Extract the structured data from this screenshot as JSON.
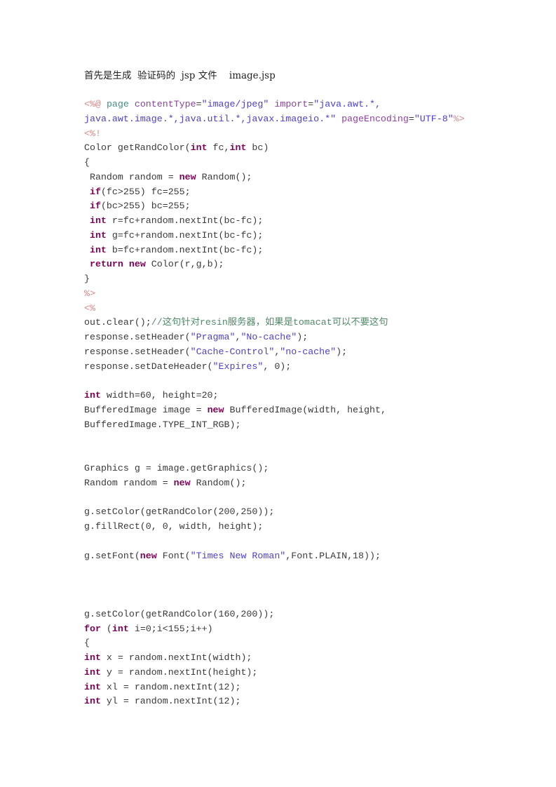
{
  "document": {
    "heading": "首先是生成  验证码的  jsp 文件    image.jsp",
    "code_lines": [
      [
        {
          "t": "tag",
          "v": "<%@"
        },
        {
          "t": "plain",
          "v": " "
        },
        {
          "t": "dir",
          "v": "page"
        },
        {
          "t": "plain",
          "v": " "
        },
        {
          "t": "attr",
          "v": "contentType"
        },
        {
          "t": "plain",
          "v": "="
        },
        {
          "t": "str",
          "v": "\"image/jpeg\""
        },
        {
          "t": "plain",
          "v": " "
        },
        {
          "t": "attr",
          "v": "import"
        },
        {
          "t": "plain",
          "v": "="
        },
        {
          "t": "str",
          "v": "\"java.awt.*,"
        }
      ],
      [
        {
          "t": "str",
          "v": "java.awt.image.*,java.util.*,javax.imageio.*\""
        },
        {
          "t": "plain",
          "v": " "
        },
        {
          "t": "attr",
          "v": "pageEncoding"
        },
        {
          "t": "plain",
          "v": "="
        },
        {
          "t": "str",
          "v": "\"UTF-8\""
        },
        {
          "t": "tag",
          "v": "%>"
        }
      ],
      [
        {
          "t": "tag",
          "v": "<%!"
        }
      ],
      [
        {
          "t": "plain",
          "v": "Color getRandColor("
        },
        {
          "t": "kw",
          "v": "int"
        },
        {
          "t": "plain",
          "v": " fc,"
        },
        {
          "t": "kw",
          "v": "int"
        },
        {
          "t": "plain",
          "v": " bc)"
        }
      ],
      [
        {
          "t": "plain",
          "v": "{"
        }
      ],
      [
        {
          "t": "plain",
          "v": " Random random = "
        },
        {
          "t": "kw",
          "v": "new"
        },
        {
          "t": "plain",
          "v": " Random();"
        }
      ],
      [
        {
          "t": "plain",
          "v": " "
        },
        {
          "t": "kw",
          "v": "if"
        },
        {
          "t": "plain",
          "v": "(fc>255) fc=255;"
        }
      ],
      [
        {
          "t": "plain",
          "v": " "
        },
        {
          "t": "kw",
          "v": "if"
        },
        {
          "t": "plain",
          "v": "(bc>255) bc=255;"
        }
      ],
      [
        {
          "t": "plain",
          "v": " "
        },
        {
          "t": "kw",
          "v": "int"
        },
        {
          "t": "plain",
          "v": " r=fc+random.nextInt(bc-fc);"
        }
      ],
      [
        {
          "t": "plain",
          "v": " "
        },
        {
          "t": "kw",
          "v": "int"
        },
        {
          "t": "plain",
          "v": " g=fc+random.nextInt(bc-fc);"
        }
      ],
      [
        {
          "t": "plain",
          "v": " "
        },
        {
          "t": "kw",
          "v": "int"
        },
        {
          "t": "plain",
          "v": " b=fc+random.nextInt(bc-fc);"
        }
      ],
      [
        {
          "t": "plain",
          "v": " "
        },
        {
          "t": "kw",
          "v": "return"
        },
        {
          "t": "plain",
          "v": " "
        },
        {
          "t": "kw",
          "v": "new"
        },
        {
          "t": "plain",
          "v": " Color(r,g,b);"
        }
      ],
      [
        {
          "t": "plain",
          "v": "}"
        }
      ],
      [
        {
          "t": "tag",
          "v": "%>"
        }
      ],
      [
        {
          "t": "tag",
          "v": "<%"
        }
      ],
      [
        {
          "t": "plain",
          "v": "out.clear();"
        },
        {
          "t": "cm",
          "v": "//这句针对resin服务器，如果是tomacat可以不要这句"
        }
      ],
      [
        {
          "t": "plain",
          "v": "response.setHeader("
        },
        {
          "t": "str",
          "v": "\"Pragma\""
        },
        {
          "t": "plain",
          "v": ","
        },
        {
          "t": "str",
          "v": "\"No-cache\""
        },
        {
          "t": "plain",
          "v": ");"
        }
      ],
      [
        {
          "t": "plain",
          "v": "response.setHeader("
        },
        {
          "t": "str",
          "v": "\"Cache-Control\""
        },
        {
          "t": "plain",
          "v": ","
        },
        {
          "t": "str",
          "v": "\"no-cache\""
        },
        {
          "t": "plain",
          "v": ");"
        }
      ],
      [
        {
          "t": "plain",
          "v": "response.setDateHeader("
        },
        {
          "t": "str",
          "v": "\"Expires\""
        },
        {
          "t": "plain",
          "v": ", 0);"
        }
      ],
      [],
      [
        {
          "t": "kw",
          "v": "int"
        },
        {
          "t": "plain",
          "v": " width=60, height=20;"
        }
      ],
      [
        {
          "t": "plain",
          "v": "BufferedImage image = "
        },
        {
          "t": "kw",
          "v": "new"
        },
        {
          "t": "plain",
          "v": " BufferedImage(width, height,"
        }
      ],
      [
        {
          "t": "plain",
          "v": "BufferedImage.TYPE_INT_RGB);"
        }
      ],
      [],
      [],
      [
        {
          "t": "plain",
          "v": "Graphics g = image.getGraphics();"
        }
      ],
      [
        {
          "t": "plain",
          "v": "Random random = "
        },
        {
          "t": "kw",
          "v": "new"
        },
        {
          "t": "plain",
          "v": " Random();"
        }
      ],
      [],
      [
        {
          "t": "plain",
          "v": "g.setColor(getRandColor(200,250));"
        }
      ],
      [
        {
          "t": "plain",
          "v": "g.fillRect(0, 0, width, height);"
        }
      ],
      [],
      [
        {
          "t": "plain",
          "v": "g.setFont("
        },
        {
          "t": "kw",
          "v": "new"
        },
        {
          "t": "plain",
          "v": " Font("
        },
        {
          "t": "str",
          "v": "\"Times New Roman\""
        },
        {
          "t": "plain",
          "v": ",Font.PLAIN,18));"
        }
      ],
      [],
      [],
      [],
      [
        {
          "t": "plain",
          "v": "g.setColor(getRandColor(160,200));"
        }
      ],
      [
        {
          "t": "kw",
          "v": "for"
        },
        {
          "t": "plain",
          "v": " ("
        },
        {
          "t": "kw",
          "v": "int"
        },
        {
          "t": "plain",
          "v": " i=0;i<155;i++)"
        }
      ],
      [
        {
          "t": "plain",
          "v": "{"
        }
      ],
      [
        {
          "t": "kw",
          "v": "int"
        },
        {
          "t": "plain",
          "v": " x = random.nextInt(width);"
        }
      ],
      [
        {
          "t": "kw",
          "v": "int"
        },
        {
          "t": "plain",
          "v": " y = random.nextInt(height);"
        }
      ],
      [
        {
          "t": "kw",
          "v": "int"
        },
        {
          "t": "plain",
          "v": " xl = random.nextInt(12);"
        }
      ],
      [
        {
          "t": "kw",
          "v": "int"
        },
        {
          "t": "plain",
          "v": " yl = random.nextInt(12);"
        }
      ]
    ]
  },
  "colors": {
    "keyword": "#7f0055",
    "string": "#4b3fd1",
    "attribute": "#8e3fa2",
    "jsp_tag": "#d98585",
    "directive": "#3f8f8a",
    "comment": "#4f8a68",
    "plain": "#3a3a3a",
    "background": "#ffffff"
  }
}
